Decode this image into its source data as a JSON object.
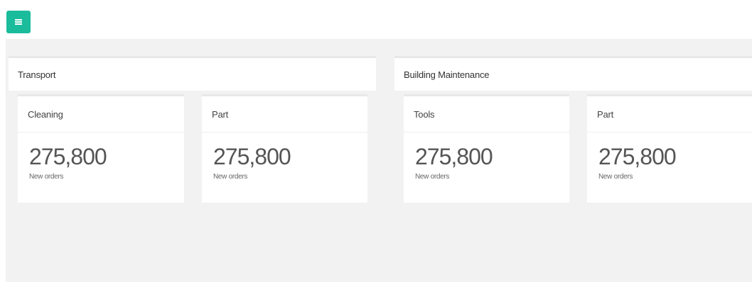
{
  "toolbar": {
    "menu_icon": "hamburger-icon",
    "accent_color": "#1abc9c"
  },
  "groups": [
    {
      "title": "Transport",
      "cards": [
        {
          "title": "Cleaning",
          "value": "275,800",
          "label": "New orders"
        },
        {
          "title": "Part",
          "value": "275,800",
          "label": "New orders"
        }
      ]
    },
    {
      "title": "Building Maintenance",
      "cards": [
        {
          "title": "Tools",
          "value": "275,800",
          "label": "New orders"
        },
        {
          "title": "Part",
          "value": "275,800",
          "label": "New orders"
        }
      ]
    }
  ]
}
